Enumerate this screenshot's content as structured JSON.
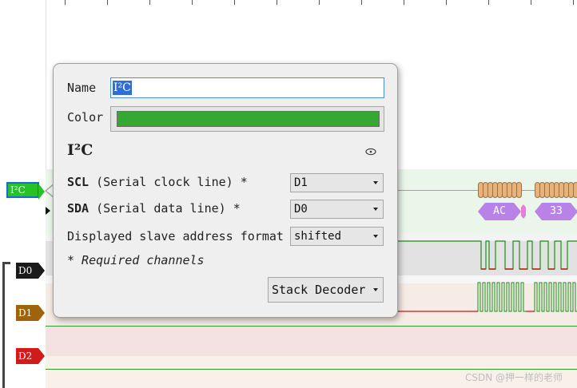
{
  "channels": {
    "i2c_label": "I²C",
    "d0_label": "D0",
    "d1_label": "D1",
    "d2_label": "D2"
  },
  "annotations": [
    "AC",
    "33"
  ],
  "dialog": {
    "name_label": "Name",
    "name_value": "I²C",
    "color_label": "Color",
    "color_value": "#33a933",
    "decoder_title": "I²C",
    "scl": {
      "label_bold": "SCL",
      "label_rest": " (Serial clock line) *",
      "value": "D1"
    },
    "sda": {
      "label_bold": "SDA",
      "label_rest": " (Serial data line) *",
      "value": "D0"
    },
    "addr_format": {
      "label": "Displayed slave address format",
      "value": "shifted"
    },
    "required_note": "* Required channels",
    "stack_button": "Stack Decoder"
  },
  "watermark": "CSDN @押一样的老师",
  "colors": {
    "i2c_label_bg": "#27c22a",
    "d0_label_bg": "#1a1a1a",
    "d1_label_bg": "#a0620a",
    "d2_label_bg": "#d11a1a",
    "annotation_purple": "#b982e8",
    "selection_blue": "#2f6fd1"
  }
}
